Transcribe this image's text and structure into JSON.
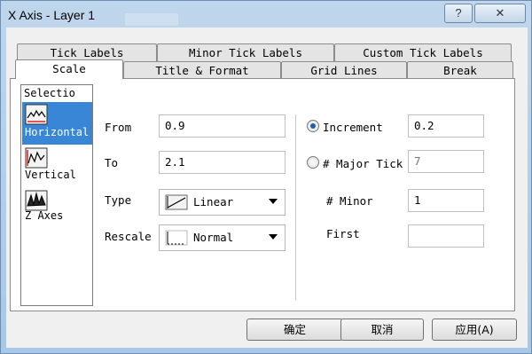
{
  "window": {
    "title": "X Axis - Layer 1",
    "help_button": "?",
    "close_button": "✕"
  },
  "tabs_back": [
    "Tick Labels",
    "Minor Tick Labels",
    "Custom Tick Labels"
  ],
  "tabs_front": [
    "Scale",
    "Title & Format",
    "Grid Lines",
    "Break"
  ],
  "active_tab": "Scale",
  "selection": {
    "caption": "Selectio",
    "items": [
      {
        "label": "Horizontal",
        "icon": "horizontal-axis-icon",
        "selected": true
      },
      {
        "label": "Vertical",
        "icon": "vertical-axis-icon",
        "selected": false
      },
      {
        "label": "Z Axes",
        "icon": "z-axes-icon",
        "selected": false
      }
    ]
  },
  "scale": {
    "from_label": "From",
    "from_value": "0.9",
    "to_label": "To",
    "to_value": "2.1",
    "type_label": "Type",
    "type_value": "Linear",
    "rescale_label": "Rescale",
    "rescale_value": "Normal",
    "increment_label": "Increment",
    "increment_value": "0.2",
    "major_ticks_label": "# Major Tick",
    "major_ticks_value": "7",
    "minor_label": "# Minor",
    "minor_value": "1",
    "first_label": "First",
    "first_value": "",
    "increment_selected": true
  },
  "buttons": {
    "ok": "确定",
    "cancel": "取消",
    "apply": "应用(A)"
  },
  "colors": {
    "selection_highlight": "#3a86d6",
    "radio_dot": "#1f5fa8"
  }
}
